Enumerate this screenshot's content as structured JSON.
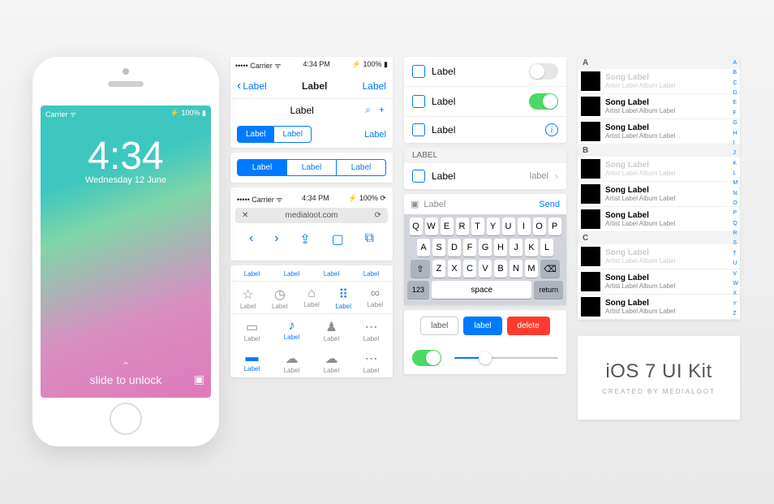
{
  "phone": {
    "status_left": "Carrier ᯤ",
    "status_right": "⚡ 100% ▮",
    "time": "4:34",
    "date": "Wednesday 12 June",
    "slide": "slide to unlock"
  },
  "col2": {
    "status": {
      "left": "••••• Carrier ᯤ",
      "center": "4:34 PM",
      "right": "⚡ 100% ▮"
    },
    "nav1": {
      "back": "Label",
      "title": "Label",
      "right": "Label"
    },
    "nav2": {
      "title": "Label",
      "icon1": "⌕",
      "icon2": "+"
    },
    "seg_small": [
      "Label",
      "Label"
    ],
    "seg_small_link": "Label",
    "seg_wide": [
      "Label",
      "Label",
      "Label"
    ],
    "browser": {
      "status": {
        "left": "••••• Carrier ᯤ",
        "center": "4:34 PM",
        "right": "⚡ 100% ⟳"
      },
      "url": "medialoot.com",
      "toolbar": [
        "‹",
        "›",
        "⇪",
        "▢",
        "⧉"
      ]
    },
    "tabs_links": [
      "Label",
      "Label",
      "Label",
      "Label"
    ],
    "tabs_icons": [
      {
        "icon": "☆",
        "label": "Label"
      },
      {
        "icon": "◷",
        "label": "Label"
      },
      {
        "icon": "⌂",
        "label": "Label"
      },
      {
        "icon": "⠿",
        "label": "Label"
      },
      {
        "icon": "∞",
        "label": "Label"
      }
    ],
    "tabs_mid": [
      {
        "icon": "▭",
        "label": "Label"
      },
      {
        "icon": "♪",
        "label": "Label"
      },
      {
        "icon": "♟",
        "label": "Label"
      },
      {
        "icon": "⋯",
        "label": "Label"
      }
    ],
    "tabs_bottom": [
      {
        "icon": "▬",
        "label": "Label"
      },
      {
        "icon": "☁",
        "label": "Label"
      },
      {
        "icon": "☁",
        "label": "Label"
      },
      {
        "icon": "⋯",
        "label": "Label"
      }
    ]
  },
  "col3": {
    "rows_top": [
      {
        "label": "Label",
        "switch": false
      },
      {
        "label": "Label",
        "switch": true
      },
      {
        "label": "Label",
        "info": true
      }
    ],
    "section": "LABEL",
    "row_detail": {
      "label": "Label",
      "value": "label"
    },
    "keyboard": {
      "placeholder": "Label",
      "send": "Send",
      "rows": [
        [
          "Q",
          "W",
          "E",
          "R",
          "T",
          "Y",
          "U",
          "I",
          "O",
          "P"
        ],
        [
          "A",
          "S",
          "D",
          "F",
          "G",
          "H",
          "J",
          "K",
          "L"
        ],
        [
          "⇧",
          "Z",
          "X",
          "C",
          "V",
          "B",
          "N",
          "M",
          "⌫"
        ]
      ],
      "fn": {
        "num": "123",
        "space": "space",
        "ret": "return"
      }
    },
    "buttons": {
      "default": "label",
      "primary": "label",
      "danger": "delete"
    }
  },
  "col4": {
    "sections": [
      "A",
      "B",
      "C"
    ],
    "song": {
      "title": "Song Label",
      "sub": "Artist Label  Album Label"
    },
    "index": [
      "A",
      "B",
      "C",
      "D",
      "E",
      "F",
      "G",
      "H",
      "I",
      "J",
      "K",
      "L",
      "M",
      "N",
      "O",
      "P",
      "Q",
      "R",
      "S",
      "T",
      "U",
      "V",
      "W",
      "X",
      "Y",
      "Z"
    ],
    "card": {
      "title": "iOS 7 UI Kit",
      "sub": "CREATED BY MEDIALOOT"
    }
  }
}
